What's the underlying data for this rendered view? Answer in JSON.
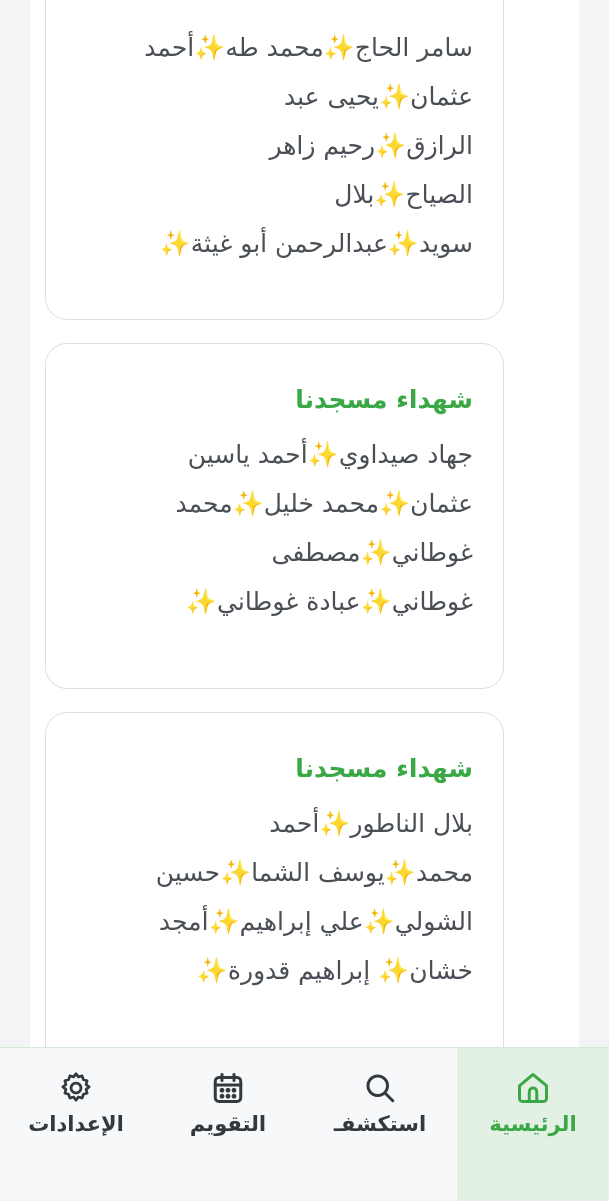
{
  "cards": [
    {
      "title": "",
      "lines": [
        "سامر الحاج✨محمد طه✨أحمد",
        "عثمان✨يحيى عبد",
        "الرازق✨رحيم زاهر",
        "الصياح✨بلال",
        "سويد✨عبدالرحمن أبو غيثة✨"
      ]
    },
    {
      "title": "شهداء مسجدنا",
      "lines": [
        "جهاد صيداوي✨أحمد ياسين",
        "عثمان✨محمد خليل✨محمد",
        "غوطاني✨مصطفى",
        "غوطاني✨عبادة غوطاني✨"
      ]
    },
    {
      "title": "شهداء مسجدنا",
      "lines": [
        "بلال الناطور✨أحمد",
        "محمد✨يوسف الشما✨حسين",
        "الشولي✨علي إبراهيم✨أمجد",
        "خشان✨ إبراهيم قدورة✨"
      ]
    }
  ],
  "tabbar": {
    "active_color": "#3aa844",
    "tabs": [
      {
        "label": "الرئيسية",
        "icon": "home-icon",
        "active": true
      },
      {
        "label": "استكشفـ",
        "icon": "search-icon",
        "active": false
      },
      {
        "label": "التقويم",
        "icon": "calendar-icon",
        "active": false
      },
      {
        "label": "الإعدادات",
        "icon": "gear-icon",
        "active": false
      }
    ]
  }
}
